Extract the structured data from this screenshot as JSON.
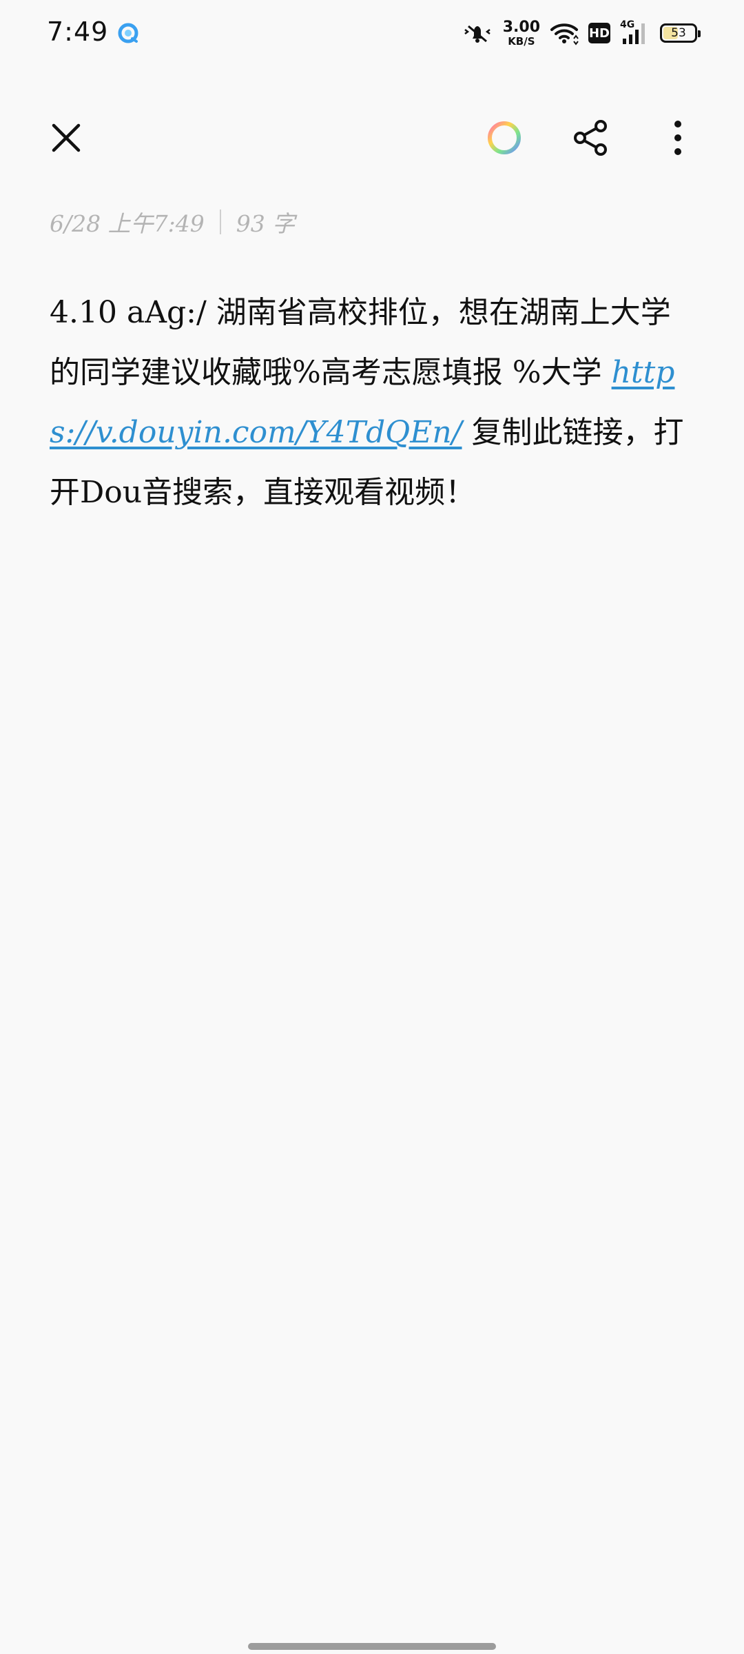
{
  "status_bar": {
    "time": "7:49",
    "net_speed_value": "3.00",
    "net_speed_unit": "KB/S",
    "hd_label": "HD",
    "network_type": "4G",
    "battery_level": "53",
    "battery_percent": 53
  },
  "toolbar": {
    "close_icon": "close-icon",
    "theme_icon": "color-ring-icon",
    "share_icon": "share-icon",
    "more_icon": "more-vertical-icon"
  },
  "note": {
    "meta_datetime": "6/28 上午7:49",
    "meta_wordcount": "93 字",
    "text_before_link": "4.10 aAg:/ 湖南省高校排位，想在湖南上大学的同学建议收藏哦%高考志愿填报 %大学 ",
    "link": "https://v.douyin.com/Y4TdQEn/",
    "text_after_link": " 复制此链接，打开Dou音搜索，直接观看视频！"
  },
  "colors": {
    "background": "#f9f9f9",
    "link": "#2e8fd0",
    "meta": "#b4b4b4"
  }
}
